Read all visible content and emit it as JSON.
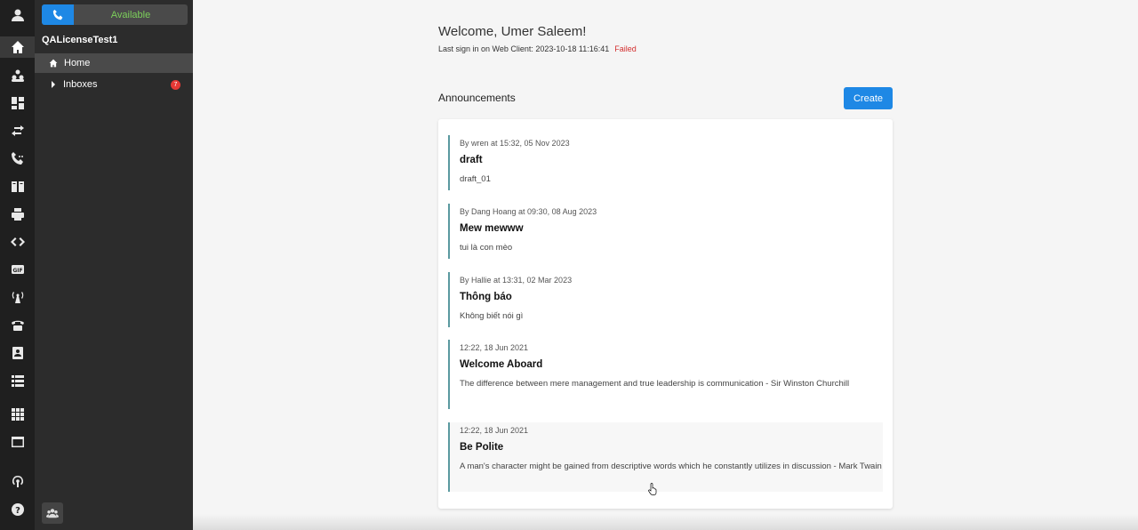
{
  "rail": {
    "icons": [
      "avatar-icon",
      "home-icon",
      "users-icon",
      "dashboard-icon",
      "transfer-icon",
      "call-log-icon",
      "directory-icon",
      "print-icon",
      "code-icon",
      "gif-icon",
      "antenna-icon",
      "telephone-icon",
      "contact-card-icon",
      "list-icon",
      "apps-grid-icon",
      "window-icon",
      "broadcast-icon",
      "help-icon"
    ]
  },
  "panel": {
    "status": "Available",
    "tenant": "QALicenseTest1",
    "nav_home": "Home",
    "nav_inboxes": "Inboxes",
    "inbox_badge": "7"
  },
  "main": {
    "welcome": "Welcome, Umer Saleem!",
    "last_sign_in": "Last sign in on Web Client: 2023-10-18 11:16:41",
    "last_sign_in_status": "Failed",
    "announcements_title": "Announcements",
    "create_label": "Create",
    "announcements": [
      {
        "meta": "By wren at 15:32, 05 Nov 2023",
        "title": "draft",
        "body": "draft_01"
      },
      {
        "meta": "By Dang Hoang at 09:30, 08 Aug 2023",
        "title": "Mew mewww",
        "body": "tui là con mèo"
      },
      {
        "meta": "By Hallie at 13:31, 02 Mar 2023",
        "title": "Thông báo",
        "body": "Không biết nói gì"
      },
      {
        "meta": "12:22, 18 Jun 2021",
        "title": "Welcome Aboard",
        "body": "The difference between mere management and true leadership is communication - Sir Winston Churchill"
      },
      {
        "meta": "12:22, 18 Jun 2021",
        "title": "Be Polite",
        "body": "A man's character might be gained from descriptive words which he constantly utilizes in discussion - Mark Twain"
      }
    ]
  },
  "colors": {
    "accent": "#1e88e5",
    "rail_bg": "#1f1f1f",
    "panel_bg": "#2c2c2c",
    "status_green": "#7ccf5b",
    "failed_red": "#d32f2f",
    "announcement_border": "#5b9aa0"
  }
}
